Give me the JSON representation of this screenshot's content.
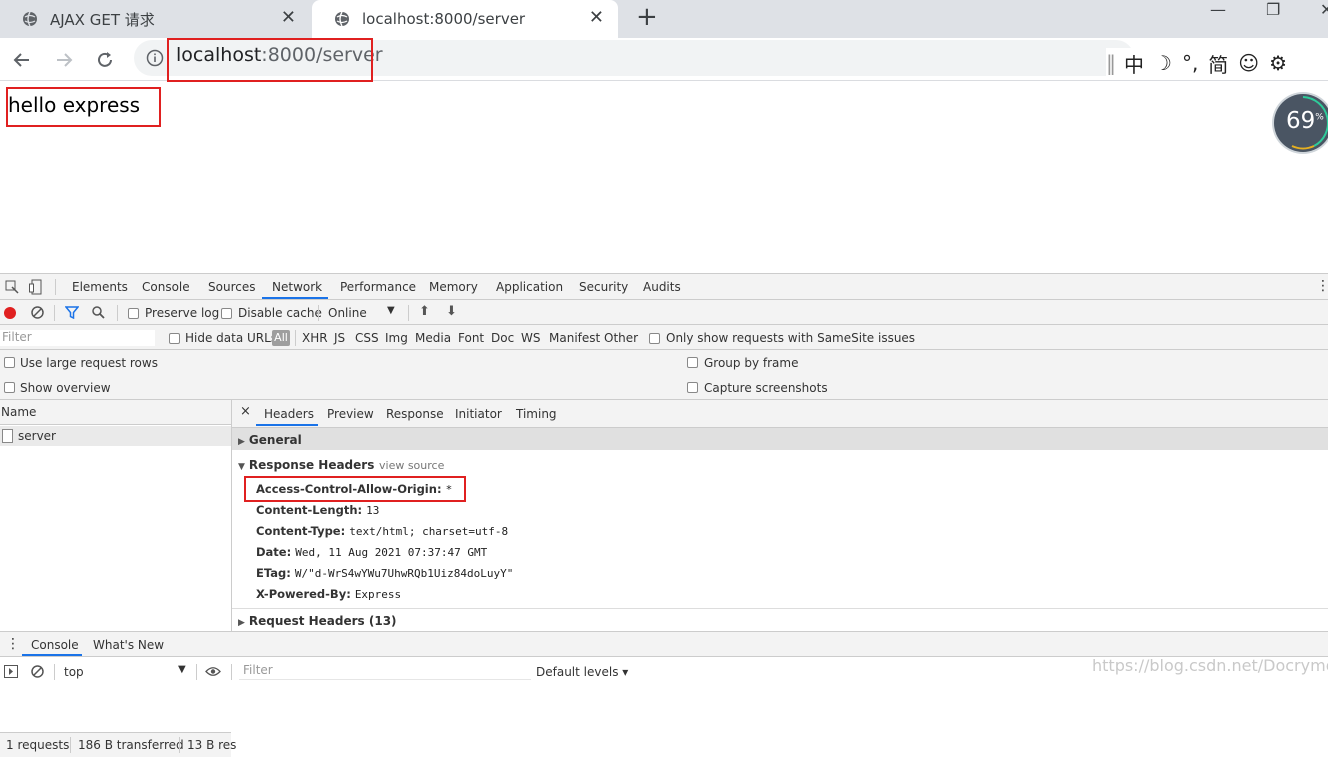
{
  "browser": {
    "tabs": [
      {
        "title": "AJAX GET 请求",
        "active": false
      },
      {
        "title": "localhost:8000/server",
        "active": true
      }
    ],
    "new_tab_label": "+",
    "url_host": "localhost",
    "url_rest": ":8000/server",
    "ime": {
      "chars": [
        "中",
        "☽",
        "°,",
        "简",
        "☺",
        "⚙"
      ]
    }
  },
  "page": {
    "body_text": "hello express",
    "gauge_value": "69",
    "gauge_unit": "%"
  },
  "devtools": {
    "tabs": [
      "Elements",
      "Console",
      "Sources",
      "Network",
      "Performance",
      "Memory",
      "Application",
      "Security",
      "Audits"
    ],
    "active_tab": "Network",
    "toolbar": {
      "preserve_log": "Preserve log",
      "disable_cache": "Disable cache",
      "throttle": "Online"
    },
    "filter": {
      "placeholder": "Filter",
      "hide_data_urls": "Hide data URLs",
      "types": [
        "All",
        "XHR",
        "JS",
        "CSS",
        "Img",
        "Media",
        "Font",
        "Doc",
        "WS",
        "Manifest",
        "Other"
      ],
      "same_site": "Only show requests with SameSite issues"
    },
    "settings": {
      "large_rows": "Use large request rows",
      "overview": "Show overview",
      "group_by_frame": "Group by frame",
      "capture_screenshots": "Capture screenshots"
    },
    "name_column": {
      "header": "Name",
      "rows": [
        "server"
      ]
    },
    "status": {
      "requests": "1 requests",
      "transferred": "186 B transferred",
      "resources": "13 B res"
    },
    "details": {
      "tabs": [
        "Headers",
        "Preview",
        "Response",
        "Initiator",
        "Timing"
      ],
      "general": "General",
      "response_headers": "Response Headers",
      "view_source": "view source",
      "headers": [
        {
          "key": "Access-Control-Allow-Origin:",
          "value": "*"
        },
        {
          "key": "Content-Length:",
          "value": "13"
        },
        {
          "key": "Content-Type:",
          "value": "text/html; charset=utf-8"
        },
        {
          "key": "Date:",
          "value": "Wed, 11 Aug 2021 07:37:47 GMT"
        },
        {
          "key": "ETag:",
          "value": "W/\"d-WrS4wYWu7UhwRQb1Uiz84doLuyY\""
        },
        {
          "key": "X-Powered-By:",
          "value": "Express"
        }
      ],
      "request_headers": "Request Headers (13)"
    },
    "drawer": {
      "tabs": [
        "Console",
        "What's New"
      ],
      "context": "top",
      "filter_placeholder": "Filter",
      "levels": "Default levels ▾"
    }
  },
  "watermark": "https://blog.csdn.net/Docrymoon",
  "colors": {
    "highlight": "#e02020",
    "accent": "#1a73e8"
  }
}
